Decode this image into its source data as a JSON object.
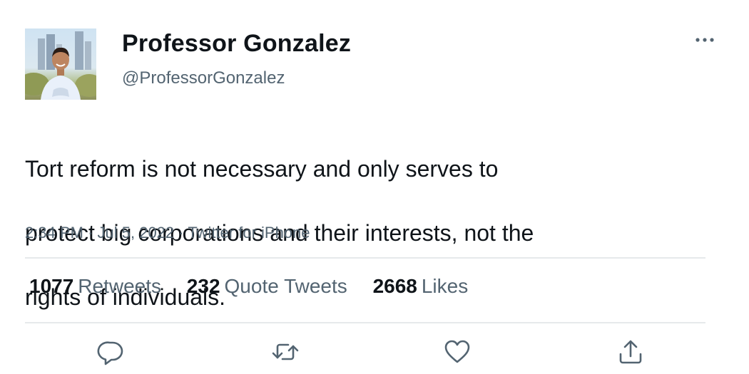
{
  "author": {
    "display_name": "Professor Gonzalez",
    "handle": "@ProfessorGonzalez"
  },
  "tweet": {
    "text_lines": [
      "Tort reform is not necessary and only serves to",
      "protect big corporations and their interests, not the",
      "rights of individuals."
    ],
    "time": "2:34 PM",
    "separator": "·",
    "date": "Jul 5, 2022",
    "source": "Twitter for iPhone"
  },
  "stats": {
    "retweets": {
      "count": "1077",
      "label": "Retweets"
    },
    "quotes": {
      "count": "232",
      "label": "Quote Tweets"
    },
    "likes": {
      "count": "2668",
      "label": "Likes"
    }
  },
  "actions": {
    "reply_icon": "reply-icon",
    "retweet_icon": "retweet-icon",
    "like_icon": "heart-icon",
    "share_icon": "share-icon",
    "more_icon": "more-horizontal-icon"
  },
  "colors": {
    "text_primary": "#0f1419",
    "text_secondary": "#536471",
    "divider": "#e6e9eb",
    "icon": "#536471"
  }
}
